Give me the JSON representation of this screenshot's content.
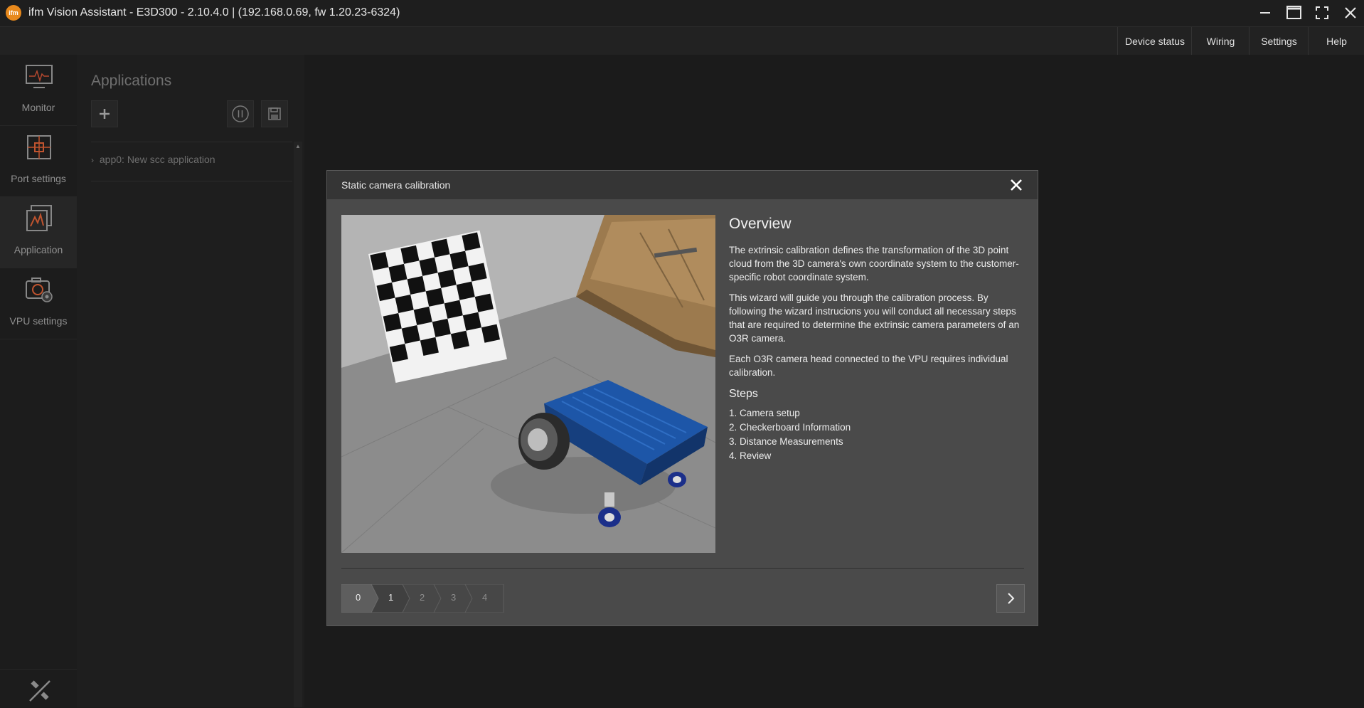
{
  "window": {
    "title": "ifm Vision Assistant - E3D300 - 2.10.4.0 |  (192.168.0.69, fw 1.20.23-6324)",
    "logo_text": "ifm"
  },
  "topnav": [
    "Device status",
    "Wiring",
    "Settings",
    "Help"
  ],
  "rail": [
    {
      "label": "Monitor",
      "icon": "monitor-icon"
    },
    {
      "label": "Port settings",
      "icon": "port-settings-icon"
    },
    {
      "label": "Application",
      "icon": "application-icon"
    },
    {
      "label": "VPU settings",
      "icon": "vpu-settings-icon"
    }
  ],
  "applications": {
    "title": "Applications",
    "items": [
      "app0: New scc application"
    ]
  },
  "dialog": {
    "title": "Static camera calibration",
    "overview_title": "Overview",
    "paragraphs": [
      "The extrinsic calibration defines the transformation of the 3D point cloud from the 3D camera's own coordinate system to the customer-specific robot coordinate system.",
      "This wizard will guide you through the calibration process. By following the wizard instrucions you will conduct all necessary steps that are required to determine the extrinsic camera parameters of an O3R camera.",
      "Each O3R camera head connected to the VPU requires individual calibration."
    ],
    "steps_title": "Steps",
    "steps": [
      "1. Camera setup",
      "2. Checkerboard Information",
      "3. Distance Measurements",
      "4. Review"
    ],
    "stepper": [
      "0",
      "1",
      "2",
      "3",
      "4"
    ],
    "current_step": 0
  },
  "colors": {
    "accent": "#e8891c",
    "robot_blue": "#1d56a8",
    "background": "#1b1b1b"
  }
}
